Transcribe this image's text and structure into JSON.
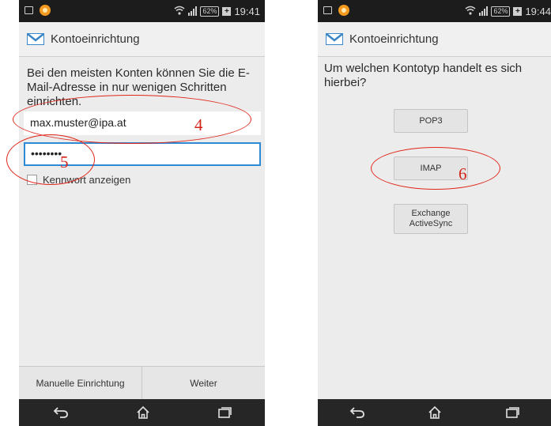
{
  "left_screen": {
    "statusbar": {
      "battery": "62%",
      "time": "19:41"
    },
    "title": "Kontoeinrichtung",
    "intro_text": "Bei den meisten Konten können Sie die E-Mail-Adresse in nur wenigen Schritten einrichten.",
    "email_value": "max.muster@ipa.at",
    "password_value": "••••••••",
    "show_password_label": "Kennwort anzeigen",
    "manual_button": "Manuelle Einrichtung",
    "next_button": "Weiter",
    "annotations": [
      "4",
      "5"
    ]
  },
  "right_screen": {
    "statusbar": {
      "battery": "62%",
      "time": "19:44"
    },
    "title": "Kontoeinrichtung",
    "question": "Um welchen Kontotyp handelt es sich hierbei?",
    "options": [
      "POP3",
      "IMAP",
      "Exchange ActiveSync"
    ],
    "annotations": [
      "6"
    ]
  },
  "colors": {
    "annotation": "#e0261a",
    "focus_border": "#2f8ad6",
    "statusbar": "#1c1c1c",
    "navbar": "#262626"
  },
  "icons": {
    "statusbar": [
      "notification-square-icon",
      "notification-orange-icon",
      "wifi-icon",
      "signal-icon",
      "battery-icon",
      "charging-plus-icon"
    ],
    "actionbar": "mail-envelope-icon",
    "navbar": [
      "back-icon",
      "home-icon",
      "recent-apps-icon"
    ]
  }
}
